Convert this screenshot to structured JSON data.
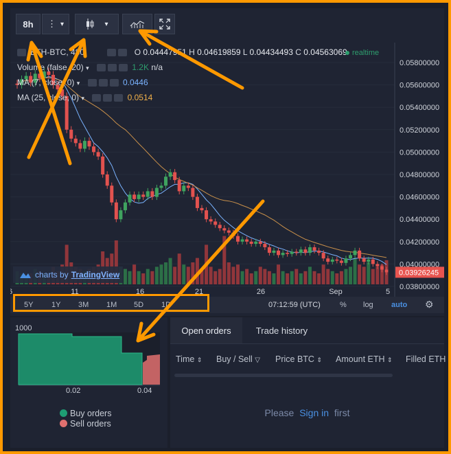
{
  "toolbar": {
    "interval_label": "8h",
    "more_label": "⋮",
    "caret": "▾",
    "icons": [
      "candle-style-icon",
      "indicators-icon",
      "fullscreen-icon"
    ]
  },
  "legend": {
    "symbol": "ETH-BTC, 480",
    "o_label": "O",
    "o_value": "0.04447951",
    "h_label": "H",
    "h_value": "0.04619859",
    "l_label": "L",
    "l_value": "0.04434493",
    "c_label": "C",
    "c_value": "0.04563069",
    "realtime": "realtime",
    "volume": "Volume (false, 20)",
    "volume_value": "1.2K",
    "volume_na": "n/a",
    "ma7": "MA (7, close, 0)",
    "ma7_value": "0.0446",
    "ma25": "MA (25, close, 0)",
    "ma25_value": "0.0514",
    "colors": {
      "ma7": "#7ab3ff",
      "ma25": "#f0b04a",
      "realtime": "#2e9e6e"
    }
  },
  "yaxis": {
    "ticks": [
      "0.05800000",
      "0.05600000",
      "0.05400000",
      "0.05200000",
      "0.05000000",
      "0.04800000",
      "0.04600000",
      "0.04400000",
      "0.04200000",
      "0.04000000",
      "0.03800000"
    ],
    "current_price": "0.03926245",
    "current_color": "#e8544f"
  },
  "xaxis": {
    "ticks": [
      "6",
      "11",
      "16",
      "21",
      "26",
      "Sep",
      "5"
    ]
  },
  "watermark": {
    "prefix": "charts by",
    "brand": "TradingView"
  },
  "rangebar": {
    "ranges": [
      "5Y",
      "1Y",
      "3M",
      "1M",
      "5D",
      "1D"
    ],
    "time": "07:12:59 (UTC)",
    "percent": "%",
    "log": "log",
    "auto": "auto"
  },
  "depth": {
    "y_label": "1000",
    "x_ticks": [
      "0.02",
      "0.04"
    ],
    "legend_buy": "Buy orders",
    "legend_sell": "Sell orders",
    "buy_color": "#1e9e74",
    "sell_color": "#e0706f"
  },
  "orders": {
    "tabs": [
      "Open orders",
      "Trade history"
    ],
    "columns": [
      "Time",
      "Buy / Sell",
      "Price BTC",
      "Amount ETH",
      "Filled ETH"
    ],
    "empty_prefix": "Please",
    "empty_link": "Sign in",
    "empty_suffix": "first"
  }
}
